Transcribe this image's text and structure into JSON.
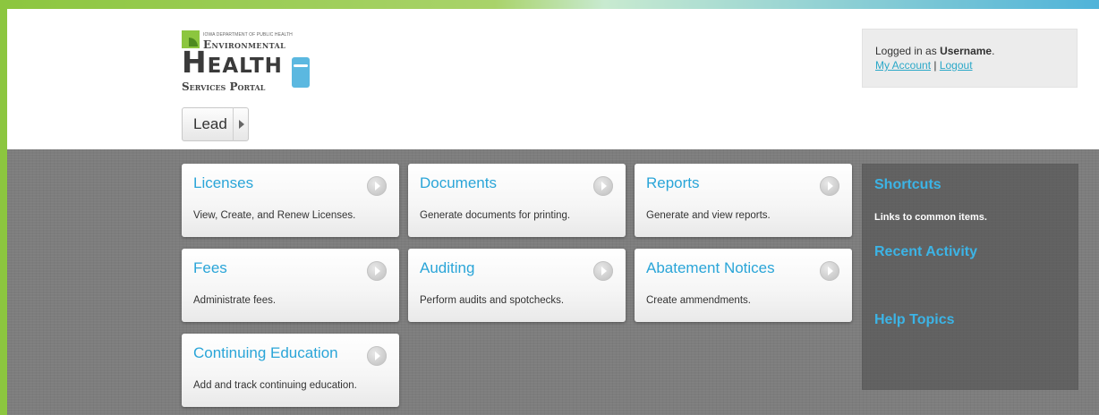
{
  "logo": {
    "dept": "IOWA DEPARTMENT OF PUBLIC HEALTH",
    "line1": "Environmental",
    "line2": "Health",
    "line3": "Services Portal"
  },
  "program_selector": {
    "label": "Lead"
  },
  "account": {
    "prefix": "Logged in as ",
    "username": "Username",
    "suffix": ".",
    "my_account": "My Account",
    "separator": " | ",
    "logout": "Logout"
  },
  "tiles": [
    {
      "title": "Licenses",
      "desc": "View, Create, and Renew Licenses."
    },
    {
      "title": "Documents",
      "desc": "Generate documents for printing."
    },
    {
      "title": "Reports",
      "desc": "Generate and view reports."
    },
    {
      "title": "Fees",
      "desc": "Administrate fees."
    },
    {
      "title": "Auditing",
      "desc": "Perform audits and spotchecks."
    },
    {
      "title": "Abatement Notices",
      "desc": "Create ammendments."
    },
    {
      "title": "Continuing Education",
      "desc": "Add and track continuing education."
    }
  ],
  "sidebar": {
    "shortcuts_heading": "Shortcuts",
    "shortcuts_text": "Links to common items.",
    "recent_heading": "Recent Activity",
    "help_heading": "Help Topics"
  },
  "colors": {
    "accent_green": "#8cc63f",
    "accent_blue": "#2aa5d8",
    "background_gray": "#7d7d7d"
  }
}
